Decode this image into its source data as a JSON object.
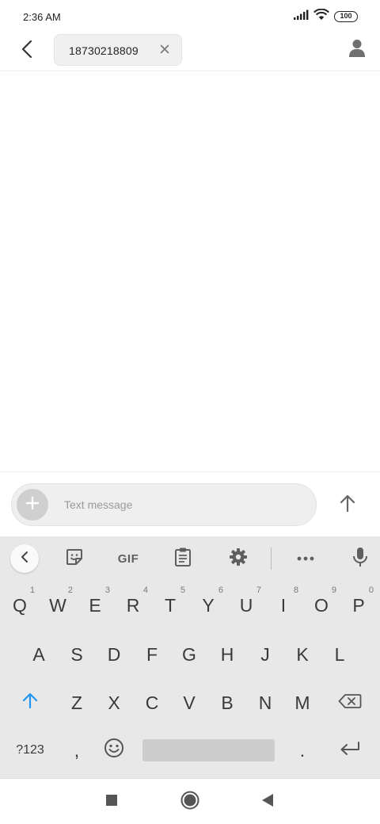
{
  "status_bar": {
    "time": "2:36 AM",
    "battery": "100",
    "icons": [
      "signal-icon",
      "wifi-icon",
      "battery-icon"
    ]
  },
  "header": {
    "back_icon": "back-arrow-icon",
    "recipient": "18730218809",
    "chip_remove_icon": "close-icon",
    "contact_icon": "person-icon"
  },
  "compose": {
    "placeholder": "Text message",
    "value": "",
    "attach_icon": "plus-icon",
    "send_icon": "arrow-up-icon"
  },
  "keyboard": {
    "toolbar": {
      "collapse_icon": "chevron-left-icon",
      "sticker_icon": "sticker-icon",
      "gif_label": "GIF",
      "clipboard_icon": "clipboard-icon",
      "settings_icon": "gear-icon",
      "more_icon": "more-horizontal-icon",
      "mic_icon": "microphone-icon"
    },
    "row1": [
      {
        "label": "Q",
        "hint": "1"
      },
      {
        "label": "W",
        "hint": "2"
      },
      {
        "label": "E",
        "hint": "3"
      },
      {
        "label": "R",
        "hint": "4"
      },
      {
        "label": "T",
        "hint": "5"
      },
      {
        "label": "Y",
        "hint": "6"
      },
      {
        "label": "U",
        "hint": "7"
      },
      {
        "label": "I",
        "hint": "8"
      },
      {
        "label": "O",
        "hint": "9"
      },
      {
        "label": "P",
        "hint": "0"
      }
    ],
    "row2": [
      "A",
      "S",
      "D",
      "F",
      "G",
      "H",
      "J",
      "K",
      "L"
    ],
    "row3": [
      "Z",
      "X",
      "C",
      "V",
      "B",
      "N",
      "M"
    ],
    "row4": {
      "symbols": "?123",
      "comma": ",",
      "period": "."
    },
    "shift_icon": "shift-arrow-icon",
    "backspace_icon": "backspace-icon",
    "emoji_icon": "emoji-icon",
    "enter_icon": "enter-icon",
    "accent_color": "#2196f3"
  },
  "nav_bar": {
    "recents_icon": "square-icon",
    "home_icon": "circle-icon",
    "back_icon": "triangle-back-icon"
  }
}
